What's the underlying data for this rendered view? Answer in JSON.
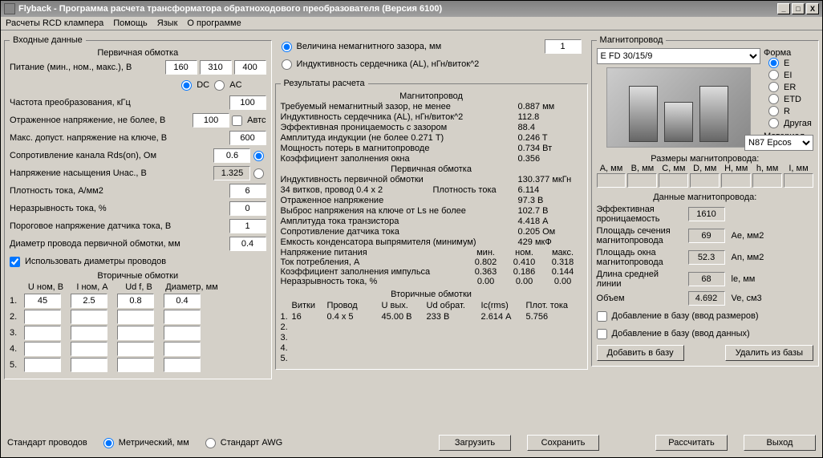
{
  "title": "Flyback - Программа расчета трансформатора обратноходового преобразователя (Версия 6100)",
  "menu": {
    "rcd": "Расчеты RCD клампера",
    "help": "Помощь",
    "lang": "Язык",
    "about": "О программе"
  },
  "input": {
    "group": "Входные данные",
    "primary": "Первичная обмотка",
    "supply_lbl": "Питание (мин., ном., макс.), В",
    "supply_min": "160",
    "supply_nom": "310",
    "supply_max": "400",
    "dc": "DC",
    "ac": "AC",
    "freq_lbl": "Частота преобразования, кГц",
    "freq": "100",
    "refl_lbl": "Отраженное напряжение, не более, В",
    "refl": "100",
    "auto": "Автс",
    "maxkey_lbl": "Макс. допуст. напряжение на ключе, В",
    "maxkey": "600",
    "rds_lbl": "Сопротивление канала Rds(on), Ом",
    "rds": "0.6",
    "usat_lbl": "Напряжение насыщения Uнас., В",
    "usat": "1.325",
    "jden_lbl": "Плотность тока, А/мм2",
    "jden": "6",
    "continuity_lbl": "Неразрывность тока, %",
    "continuity": "0",
    "thresh_lbl": "Пороговое напряжение датчика тока, В",
    "thresh": "1",
    "pwd_lbl": "Диаметр провода первичной обмотки, мм",
    "pwd": "0.4",
    "use_wire": "Использовать диаметры проводов",
    "secondaries": "Вторичные обмотки",
    "sec_cols": {
      "u": "U ном, В",
      "i": "I ном, А",
      "udf": "Ud f, В",
      "d": "Диаметр, мм"
    },
    "sec_rows": [
      {
        "n": "1.",
        "u": "45",
        "i": "2.5",
        "udf": "0.8",
        "d": "0.4"
      },
      {
        "n": "2.",
        "u": "",
        "i": "",
        "udf": "",
        "d": ""
      },
      {
        "n": "3.",
        "u": "",
        "i": "",
        "udf": "",
        "d": ""
      },
      {
        "n": "4.",
        "u": "",
        "i": "",
        "udf": "",
        "d": ""
      },
      {
        "n": "5.",
        "u": "",
        "i": "",
        "udf": "",
        "d": ""
      }
    ]
  },
  "calcopt": {
    "gap": "Величина немагнитного зазора, мм",
    "al": "Индуктивность сердечника (AL), нГн/виток^2",
    "gapval": "1"
  },
  "results": {
    "group": "Результаты расчета",
    "core_hdr": "Магнитопровод",
    "lines_core": [
      {
        "l": "Требуемый немагнитный зазор, не менее",
        "v": "0.887 мм"
      },
      {
        "l": "Индуктивность сердечника (AL), нГн/виток^2",
        "v": "112.8"
      },
      {
        "l": "Эффективная проницаемость с зазором",
        "v": "88.4"
      },
      {
        "l": "Амплитуда индукции        (не более 0.271 T)",
        "v": "0.246 T"
      },
      {
        "l": "Мощность потерь в магнитопроводе",
        "v": "0.734 Вт"
      },
      {
        "l": "Коэффициент заполнения окна",
        "v": "0.356"
      }
    ],
    "prim_hdr": "Первичная обмотка",
    "prim_line1": "Индуктивность первичной обмотки",
    "prim_line1_v": "130.377 мкГн",
    "prim_line2a": "   34 витков, провод 0.4 x 2",
    "prim_line2b": "Плотность тока",
    "prim_line2_v": "6.114",
    "lines_prim": [
      {
        "l": "Отраженное напряжение",
        "v": "97.3 В"
      },
      {
        "l": "Выброс напряжения на ключе от Ls не более",
        "v": "102.7 В"
      },
      {
        "l": "Амплитуда тока транзистора",
        "v": "4.418 А"
      },
      {
        "l": "Сопротивление датчика тока",
        "v": "0.205 Ом"
      },
      {
        "l": "Емкость конденсатора выпрямителя (минимум)",
        "v": "429 мкФ"
      }
    ],
    "supply_hdr": "Напряжение питания",
    "cols3": {
      "min": "мин.",
      "nom": "ном.",
      "max": "макс."
    },
    "tri_rows": [
      {
        "l": "Ток потребления, А",
        "a": "0.802",
        "b": "0.410",
        "c": "0.318"
      },
      {
        "l": "Коэффициент заполнения импульса",
        "a": "0.363",
        "b": "0.186",
        "c": "0.144"
      },
      {
        "l": "Неразрывность тока, %",
        "a": "0.00",
        "b": "0.00",
        "c": "0.00"
      }
    ],
    "sec_hdr": "Вторичные обмотки",
    "sec_cols": {
      "turns": "Витки",
      "wire": "Провод",
      "u": "U вых.",
      "ud": "Ud обрат.",
      "ic": "Ic(rms)",
      "j": "Плот. тока"
    },
    "sec_rows": [
      {
        "n": "1.",
        "turns": "16",
        "wire": "0.4 x 5",
        "u": "45.00 В",
        "ud": "233 В",
        "ic": "2.614 А",
        "j": "5.756"
      },
      {
        "n": "2.",
        "turns": "",
        "wire": "",
        "u": "",
        "ud": "",
        "ic": "",
        "j": ""
      },
      {
        "n": "3.",
        "turns": "",
        "wire": "",
        "u": "",
        "ud": "",
        "ic": "",
        "j": ""
      },
      {
        "n": "4.",
        "turns": "",
        "wire": "",
        "u": "",
        "ud": "",
        "ic": "",
        "j": ""
      },
      {
        "n": "5.",
        "turns": "",
        "wire": "",
        "u": "",
        "ud": "",
        "ic": "",
        "j": ""
      }
    ]
  },
  "core": {
    "group": "Магнитопровод",
    "select": "E FD 30/15/9",
    "shape_lbl": "Форма",
    "shapes": [
      "E",
      "EI",
      "ER",
      "ETD",
      "R",
      "Другая"
    ],
    "material_lbl": "Материал",
    "material": "N87 Epcos",
    "dims_lbl": "Размеры магнитопровода:",
    "dims": [
      "A, мм",
      "B, мм",
      "C, мм",
      "D, мм",
      "H, мм",
      "h, мм",
      "I, мм"
    ],
    "data_lbl": "Данные магнитопровода:",
    "data": [
      {
        "l": "Эффективная проницаемость",
        "v": "1610",
        "u": ""
      },
      {
        "l": "Площадь сечения магнитопровода",
        "v": "69",
        "u": "Ae, мм2"
      },
      {
        "l": "Площадь окна магнитопровода",
        "v": "52.3",
        "u": "An, мм2"
      },
      {
        "l": "Длина средней линии",
        "v": "68",
        "u": "le, мм"
      },
      {
        "l": "Объем",
        "v": "4.692",
        "u": "Ve, см3"
      }
    ],
    "chk_dims": "Добавление в базу (ввод размеров)",
    "chk_data": "Добавление в базу (ввод данных)",
    "btn_add": "Добавить в базу",
    "btn_del": "Удалить из базы"
  },
  "footer": {
    "std_lbl": "Стандарт проводов",
    "metric": "Метрический, мм",
    "awg": "Стандарт AWG",
    "load": "Загрузить",
    "save": "Сохранить",
    "calc": "Рассчитать",
    "exit": "Выход"
  }
}
